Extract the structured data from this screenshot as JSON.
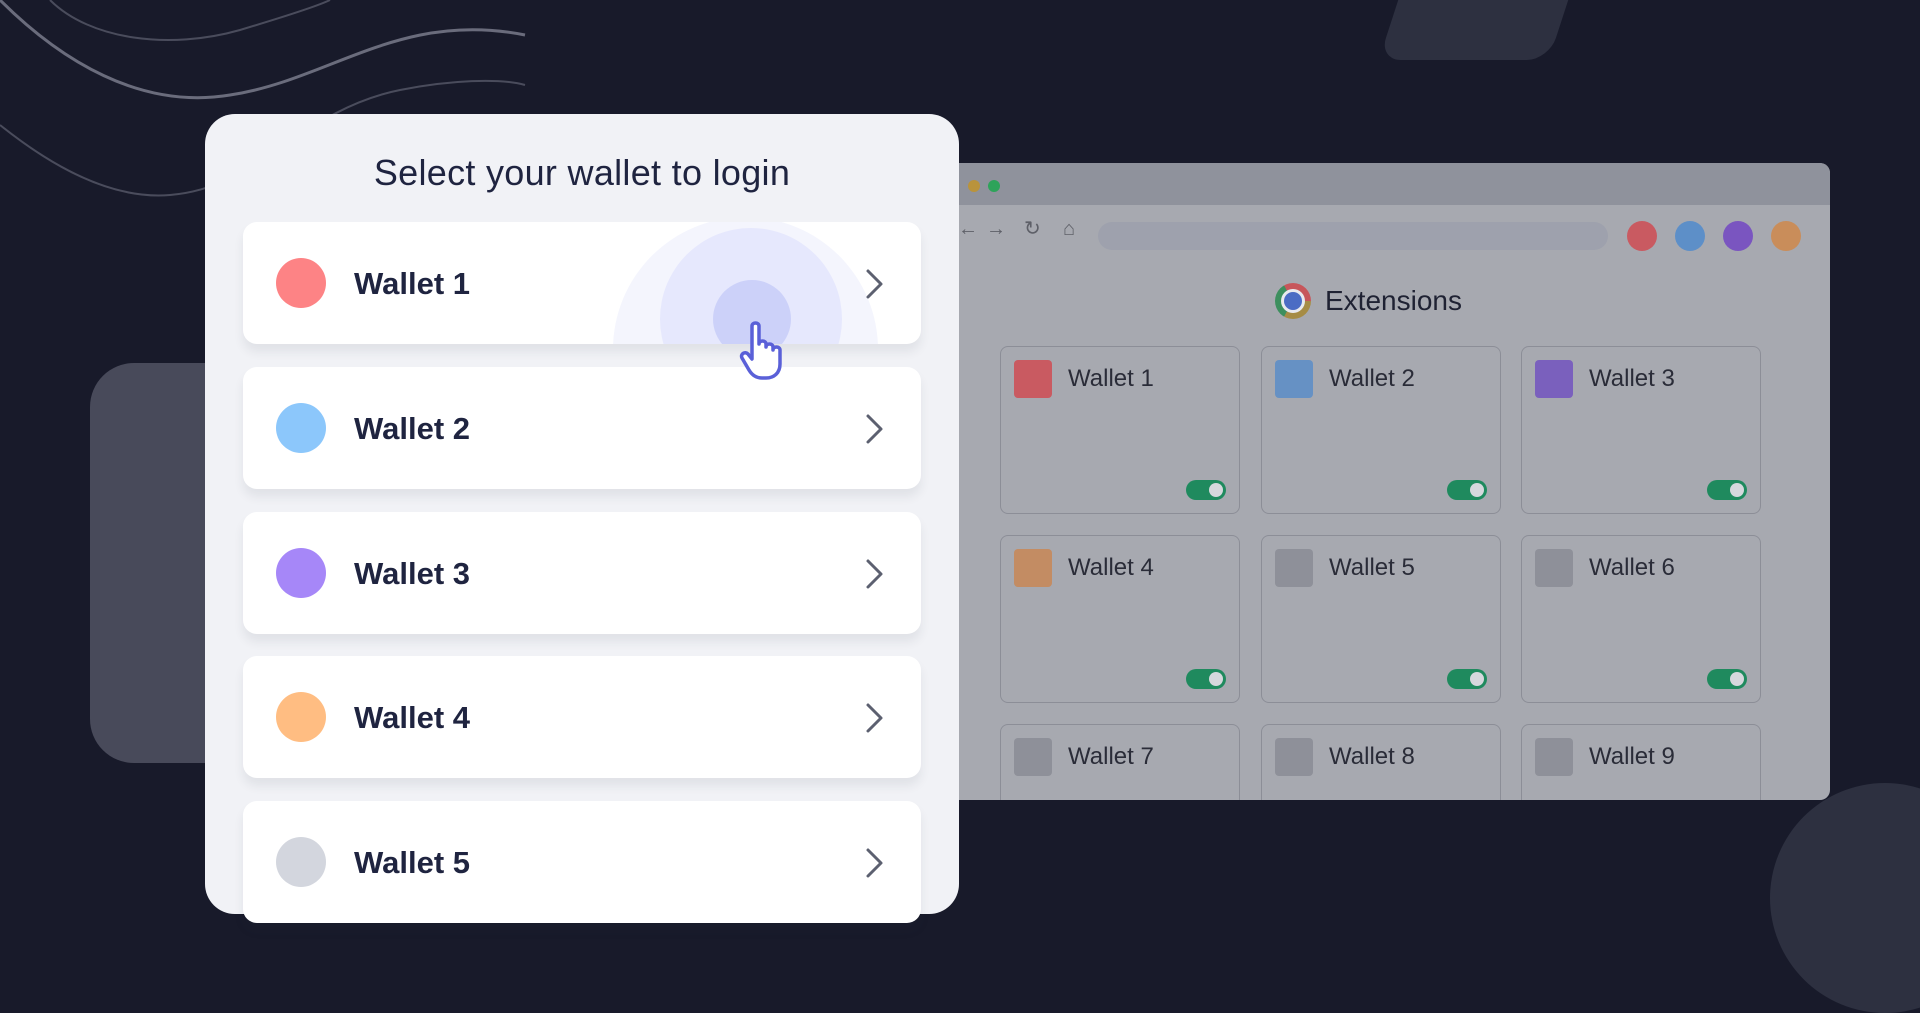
{
  "login": {
    "title": "Select your wallet to login",
    "wallets": [
      {
        "label": "Wallet 1",
        "color": "#fd8385"
      },
      {
        "label": "Wallet 2",
        "color": "#8cc7fb"
      },
      {
        "label": "Wallet 3",
        "color": "#a687f8"
      },
      {
        "label": "Wallet 4",
        "color": "#ffbd82"
      },
      {
        "label": "Wallet 5",
        "color": "#d3d6de"
      }
    ]
  },
  "browser": {
    "nav_icons": [
      "back-arrow-icon",
      "forward-arrow-icon",
      "reload-icon",
      "home-icon"
    ],
    "profile_colors": [
      "#c95a61",
      "#5d8fc8",
      "#7a55c0",
      "#c98d5a"
    ],
    "extensions_title": "Extensions",
    "extensions": [
      {
        "label": "Wallet 1",
        "color": "#c95a61",
        "enabled": true
      },
      {
        "label": "Wallet 2",
        "color": "#6691c4",
        "enabled": true
      },
      {
        "label": "Wallet 3",
        "color": "#7a60bd",
        "enabled": true
      },
      {
        "label": "Wallet 4",
        "color": "#c38c63",
        "enabled": true
      },
      {
        "label": "Wallet 5",
        "color": "#8e9099",
        "enabled": true
      },
      {
        "label": "Wallet 6",
        "color": "#8e9099",
        "enabled": true
      },
      {
        "label": "Wallet 7",
        "color": "#8e9099"
      },
      {
        "label": "Wallet 8",
        "color": "#8e9099"
      },
      {
        "label": "Wallet 9",
        "color": "#8e9099"
      }
    ]
  }
}
